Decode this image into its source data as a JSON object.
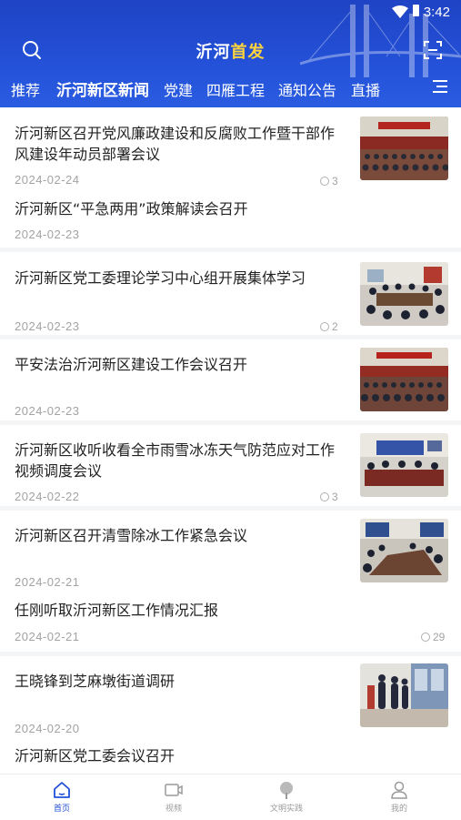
{
  "status": {
    "time": "3:42"
  },
  "header": {
    "title_main": "沂河",
    "title_accent": "首发"
  },
  "tabs": [
    {
      "label": "推荐"
    },
    {
      "label": "沂河新区新闻"
    },
    {
      "label": "党建"
    },
    {
      "label": "四雁工程"
    },
    {
      "label": "通知公告"
    },
    {
      "label": "直播"
    }
  ],
  "news": [
    {
      "title": "沂河新区召开党风廉政建设和反腐败工作暨干部作风建设年动员部署会议",
      "date": "2024-02-24",
      "count": "3",
      "thumb": "meeting-hall"
    },
    {
      "title": "沂河新区“平急两用”政策解读会召开",
      "date": "2024-02-23"
    },
    {
      "title": "沂河新区党工委理论学习中心组开展集体学习",
      "date": "2024-02-23",
      "count": "2",
      "thumb": "conference-table"
    },
    {
      "title": "平安法治沂河新区建设工作会议召开",
      "date": "2024-02-23",
      "thumb": "meeting-hall"
    },
    {
      "title": "沂河新区收听收看全市雨雪冰冻天气防范应对工作视频调度会议",
      "date": "2024-02-22",
      "count": "3",
      "thumb": "video-meeting"
    },
    {
      "title": "沂河新区召开清雪除冰工作紧急会议",
      "date": "2024-02-21",
      "thumb": "conference-room"
    },
    {
      "title": "任刚听取沂河新区工作情况汇报",
      "date": "2024-02-21",
      "count": "29"
    },
    {
      "title": "王晓锋到芝麻墩街道调研",
      "date": "2024-02-20",
      "thumb": "office-visit"
    },
    {
      "title": "沂河新区党工委会议召开"
    }
  ],
  "bottom_nav": [
    {
      "label": "首页",
      "icon": "home-icon"
    },
    {
      "label": "视频",
      "icon": "video-icon"
    },
    {
      "label": "文明实践",
      "icon": "tree-icon"
    },
    {
      "label": "我的",
      "icon": "user-icon"
    }
  ],
  "colors": {
    "brand": "#2350d6",
    "accent": "#ffd43b"
  }
}
